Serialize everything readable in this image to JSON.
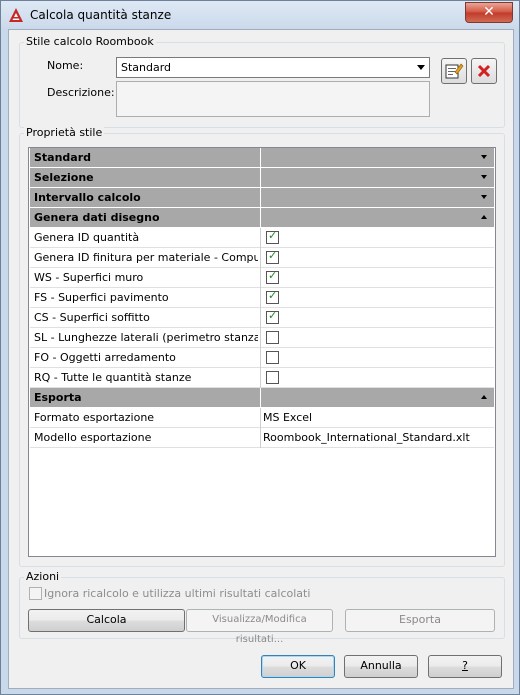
{
  "window": {
    "title": "Calcola quantità stanze",
    "close_label": "✕"
  },
  "style_group": {
    "label": "Stile calcolo Roombook",
    "name_label": "Nome:",
    "name_value": "Standard",
    "description_label": "Descrizione:",
    "description_value": ""
  },
  "properties": {
    "label": "Proprietà stile",
    "rows": [
      {
        "label": "Standard",
        "type": "category",
        "expanded": false
      },
      {
        "label": "Selezione",
        "type": "category",
        "expanded": false
      },
      {
        "label": "Intervallo calcolo",
        "type": "category",
        "expanded": false
      },
      {
        "label": "Genera dati disegno",
        "type": "category",
        "expanded": true
      },
      {
        "label": "Genera ID quantità",
        "type": "check",
        "checked": true
      },
      {
        "label": "Genera ID finitura per materiale - Computo",
        "type": "check",
        "checked": true
      },
      {
        "label": "WS - Superfici muro",
        "type": "check",
        "checked": true
      },
      {
        "label": "FS - Superfici pavimento",
        "type": "check",
        "checked": true
      },
      {
        "label": "CS - Superfici soffitto",
        "type": "check",
        "checked": true
      },
      {
        "label": "SL - Lunghezze laterali (perimetro stanza)",
        "type": "check",
        "checked": false
      },
      {
        "label": "FO - Oggetti arredamento",
        "type": "check",
        "checked": false
      },
      {
        "label": "RQ - Tutte le quantità stanze",
        "type": "check",
        "checked": false
      },
      {
        "label": "Esporta",
        "type": "category",
        "expanded": true
      },
      {
        "label": "Formato esportazione",
        "type": "value",
        "value": "MS Excel"
      },
      {
        "label": "Modello esportazione",
        "type": "value",
        "value": "Roombook_International_Standard.xlt"
      }
    ]
  },
  "actions": {
    "label": "Azioni",
    "ignore_label": "Ignora ricalcolo e utilizza ultimi risultati calcolati",
    "calc_label": "Calcola",
    "view_label": "Visualizza/Modifica risultati...",
    "export_label": "Esporta"
  },
  "footer": {
    "ok_label": "OK",
    "cancel_label": "Annulla",
    "help_label": "?"
  },
  "colors": {
    "category_bg": "#a8a8a8",
    "check_color": "#1b8a1b",
    "close_red": "#c0392b"
  }
}
